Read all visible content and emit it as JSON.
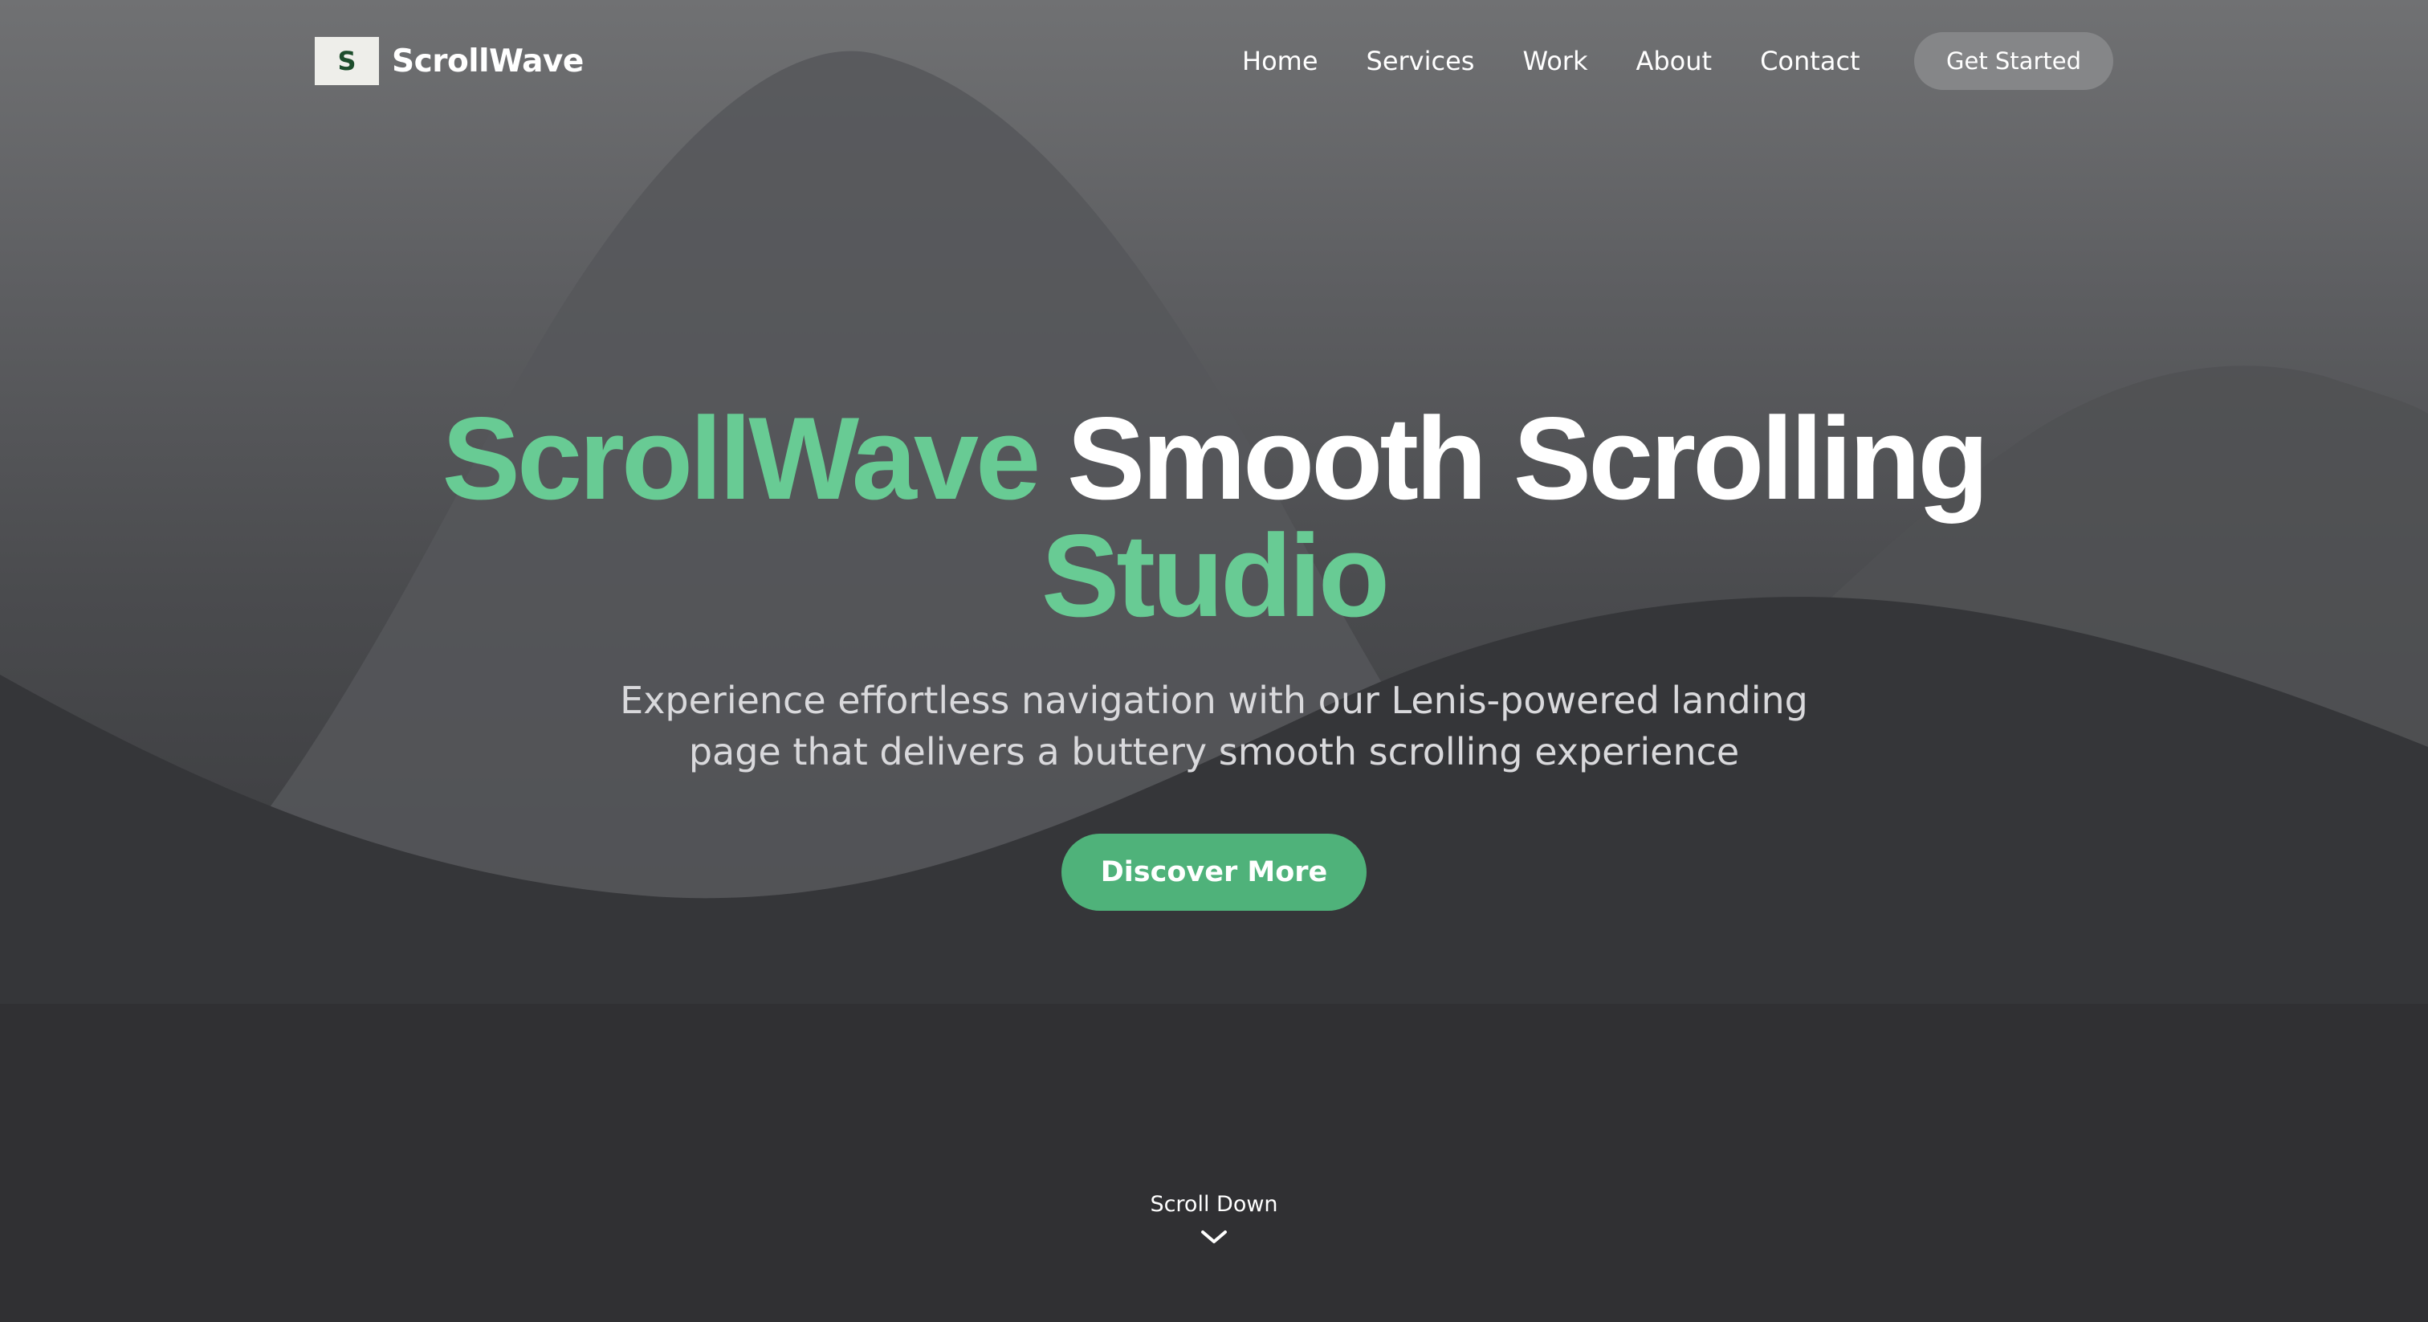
{
  "brand": {
    "logo_letter": "S",
    "name": "ScrollWave"
  },
  "nav": {
    "links": [
      "Home",
      "Services",
      "Work",
      "About",
      "Contact"
    ],
    "cta_label": "Get Started"
  },
  "hero": {
    "title_accent": "ScrollWave",
    "title_main": "Smooth Scrolling",
    "title_line2": "Studio",
    "subtitle": "Experience effortless navigation with our Lenis-powered landing page that delivers a buttery smooth scrolling experience",
    "button_label": "Discover More",
    "scroll_label": "Scroll Down"
  },
  "colors": {
    "accent": "#68cb94",
    "button": "#4fb27a",
    "nav_cta": "#858688",
    "background_top": "#707173",
    "background_bottom": "#2b2c2f"
  },
  "icons": {
    "scroll": "chevron-down-icon"
  }
}
